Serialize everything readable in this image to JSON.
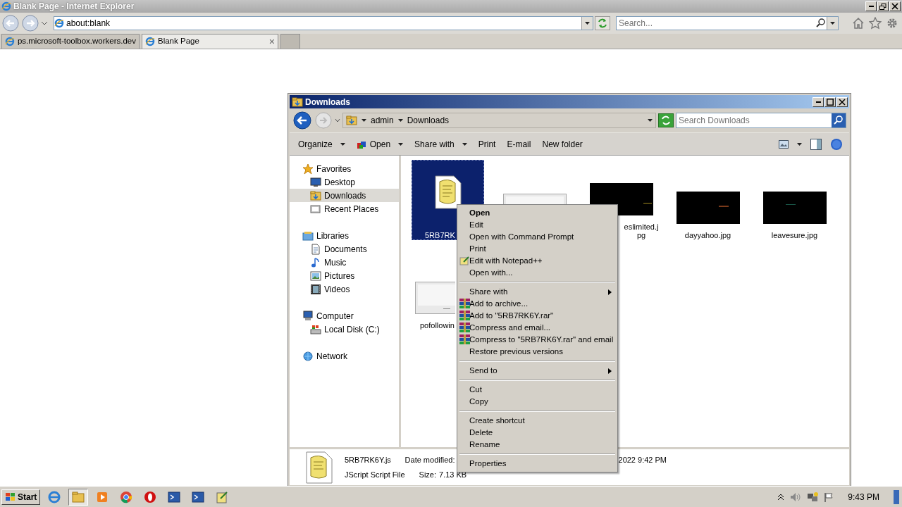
{
  "browser": {
    "title": "Blank Page - Internet Explorer",
    "address": "about:blank",
    "search_placeholder": "Search...",
    "tabs": [
      {
        "label": "ps.microsoft-toolbox.workers.dev",
        "selected": false
      },
      {
        "label": "Blank Page",
        "selected": true,
        "close": "×"
      }
    ]
  },
  "explorer": {
    "title": "Downloads",
    "breadcrumb": [
      "admin",
      "Downloads"
    ],
    "search_placeholder": "Search Downloads",
    "toolbar": [
      {
        "label": "Organize",
        "dropdown": true
      },
      {
        "label": "Open",
        "dropdown": true
      },
      {
        "label": "Share with",
        "dropdown": true
      },
      {
        "label": "Print",
        "dropdown": false
      },
      {
        "label": "E-mail",
        "dropdown": false
      },
      {
        "label": "New folder",
        "dropdown": false
      }
    ],
    "nav": [
      {
        "label": "Favorites",
        "selected": false,
        "children": [
          {
            "label": "Desktop",
            "selected": false
          },
          {
            "label": "Downloads",
            "selected": true
          },
          {
            "label": "Recent Places",
            "selected": false
          }
        ]
      },
      {
        "label": "Libraries",
        "selected": false,
        "children": [
          {
            "label": "Documents",
            "selected": false
          },
          {
            "label": "Music",
            "selected": false
          },
          {
            "label": "Pictures",
            "selected": false
          },
          {
            "label": "Videos",
            "selected": false
          }
        ]
      },
      {
        "label": "Computer",
        "selected": false,
        "children": [
          {
            "label": "Local Disk (C:)",
            "selected": false
          }
        ]
      },
      {
        "label": "Network",
        "selected": false
      }
    ],
    "files": [
      {
        "name": "5RB7RK",
        "kind": "script",
        "selected": true
      },
      {
        "kind": "picture",
        "selected": false
      },
      {
        "name": "eslimited.jpg",
        "kind": "picture",
        "selected": false
      },
      {
        "name": "dayyahoo.jpg",
        "kind": "picture",
        "selected": false
      },
      {
        "name": "leavesure.jpg",
        "kind": "picture",
        "selected": false
      },
      {
        "name": "pofollowin",
        "kind": "picture",
        "selected": false
      }
    ],
    "details": {
      "name": "5RB7RK6Y.js",
      "type": "JScript Script File",
      "fields": [
        {
          "label": "Date modified:",
          "value": "2022 9:42 PM"
        },
        {
          "label": "Size:",
          "value": "7.13 KB"
        }
      ]
    }
  },
  "context_menu": [
    {
      "kind": "action",
      "label": "Open",
      "default": true
    },
    {
      "kind": "action",
      "label": "Edit",
      "default": false
    },
    {
      "kind": "action",
      "label": "Open with Command Prompt",
      "default": false
    },
    {
      "kind": "action",
      "label": "Print",
      "default": false
    },
    {
      "kind": "editor",
      "label": "Edit with Notepad++",
      "default": false
    },
    {
      "kind": "action",
      "label": "Open with...",
      "default": false
    },
    {
      "kind": "separator"
    },
    {
      "kind": "submenu",
      "label": "Share with",
      "default": false
    },
    {
      "kind": "archiver",
      "label": "Add to archive...",
      "default": false
    },
    {
      "kind": "archiver",
      "label": "Add to \"5RB7RK6Y.rar\"",
      "default": false
    },
    {
      "kind": "archiver",
      "label": "Compress and email...",
      "default": false
    },
    {
      "kind": "archiver",
      "label": "Compress to \"5RB7RK6Y.rar\" and email",
      "default": false
    },
    {
      "kind": "action",
      "label": "Restore previous versions",
      "default": false
    },
    {
      "kind": "separator"
    },
    {
      "kind": "submenu",
      "label": "Send to",
      "default": false
    },
    {
      "kind": "separator"
    },
    {
      "kind": "action",
      "label": "Cut",
      "default": false
    },
    {
      "kind": "action",
      "label": "Copy",
      "default": false
    },
    {
      "kind": "separator"
    },
    {
      "kind": "action",
      "label": "Create shortcut",
      "default": false
    },
    {
      "kind": "action",
      "label": "Delete",
      "default": false
    },
    {
      "kind": "action",
      "label": "Rename",
      "default": false
    },
    {
      "kind": "separator"
    },
    {
      "kind": "action",
      "label": "Properties",
      "default": false
    }
  ],
  "taskbar": {
    "start": "Start",
    "apps": [
      {
        "active": false
      },
      {
        "active": true
      },
      {
        "active": false
      },
      {
        "active": false
      },
      {
        "active": false
      },
      {
        "active": false
      },
      {
        "active": false
      },
      {
        "active": false
      }
    ],
    "clock": "9:43 PM"
  }
}
